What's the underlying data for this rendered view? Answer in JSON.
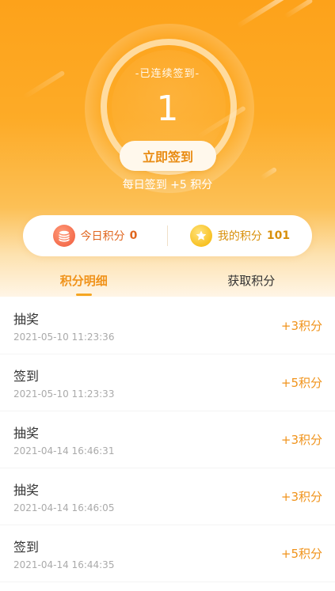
{
  "header": {
    "streak_label": "-已连续签到-",
    "streak_count": "1",
    "signin_button": "立即签到",
    "daily_note": "每日签到 +5 积分"
  },
  "summary": {
    "today_label": "今日积分",
    "today_value": "0",
    "mine_label": "我的积分",
    "mine_value": "101"
  },
  "tabs": [
    {
      "label": "积分明细",
      "active": true
    },
    {
      "label": "获取积分",
      "active": false
    }
  ],
  "records": [
    {
      "title": "抽奖",
      "time": "2021-05-10 11:23:36",
      "points": "+3积分"
    },
    {
      "title": "签到",
      "time": "2021-05-10 11:23:33",
      "points": "+5积分"
    },
    {
      "title": "抽奖",
      "time": "2021-04-14 16:46:31",
      "points": "+3积分"
    },
    {
      "title": "抽奖",
      "time": "2021-04-14 16:46:05",
      "points": "+3积分"
    },
    {
      "title": "签到",
      "time": "2021-04-14 16:44:35",
      "points": "+5积分"
    }
  ],
  "colors": {
    "accent": "#f0931b",
    "header_top": "#fda21a",
    "coin_icon": "#f05a3a",
    "star_icon": "#f5b400"
  },
  "icons": {
    "today": "coin-stack-icon",
    "mine": "star-badge-icon"
  }
}
